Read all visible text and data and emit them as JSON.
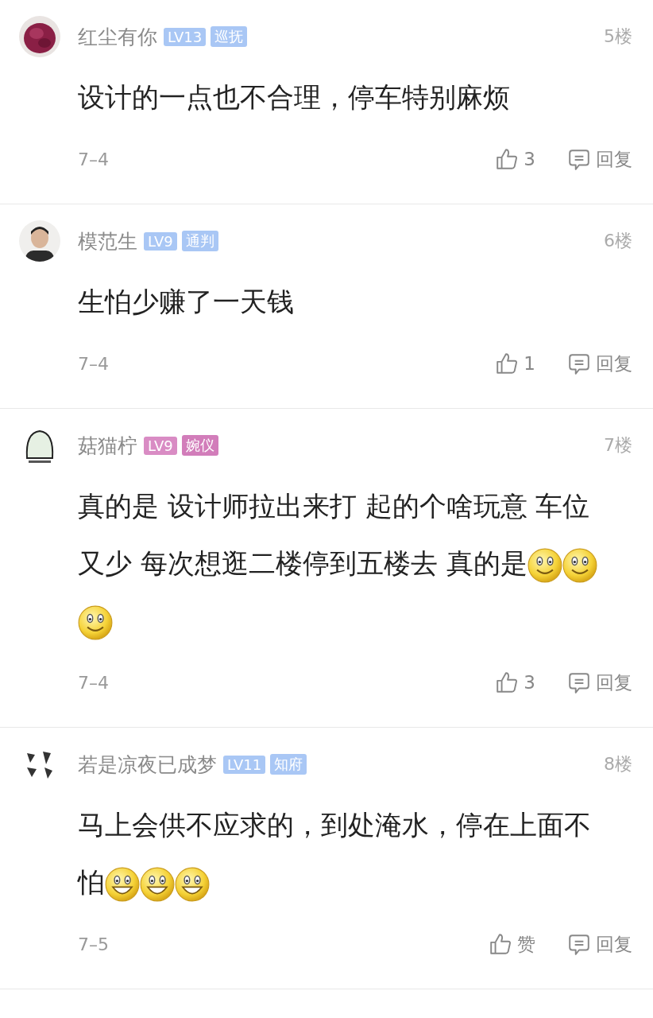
{
  "comments": [
    {
      "avatar": {
        "kind": "picture"
      },
      "name": "红尘有你",
      "badges": [
        {
          "text": "LV13",
          "color": "#a9c7f5"
        },
        {
          "text": "巡抚",
          "color": "#a9c7f5"
        }
      ],
      "floor": "5楼",
      "content": [
        {
          "kind": "text",
          "text": "设计的一点也不合理，停车特别麻烦"
        }
      ],
      "date": "7–4",
      "like": "3",
      "reply": "回复"
    },
    {
      "avatar": {
        "kind": "picture"
      },
      "name": "模范生",
      "badges": [
        {
          "text": "LV9",
          "color": "#a9c7f5"
        },
        {
          "text": "通判",
          "color": "#a9c7f5"
        }
      ],
      "floor": "6楼",
      "content": [
        {
          "kind": "text",
          "text": "生怕少赚了一天钱"
        }
      ],
      "date": "7–4",
      "like": "1",
      "reply": "回复"
    },
    {
      "avatar": {
        "kind": "picture"
      },
      "name": "菇猫柠",
      "badges": [
        {
          "text": "LV9",
          "color": "#d98cc4"
        },
        {
          "text": "婉仪",
          "color": "#d27dba"
        }
      ],
      "floor": "7楼",
      "content": [
        {
          "kind": "text",
          "text": "真的是 设计师拉出来打 起的个啥玩意 车位又少 每次想逛二楼停到五楼去 真的是"
        },
        {
          "kind": "smile"
        },
        {
          "kind": "smile"
        },
        {
          "kind": "smile"
        }
      ],
      "date": "7–4",
      "like": "3",
      "reply": "回复"
    },
    {
      "avatar": {
        "kind": "picture"
      },
      "name": "若是凉夜已成梦",
      "badges": [
        {
          "text": "LV11",
          "color": "#a9c7f5"
        },
        {
          "text": "知府",
          "color": "#a9c7f5"
        }
      ],
      "floor": "8楼",
      "content": [
        {
          "kind": "text",
          "text": "马上会供不应求的，到处淹水，停在上面不怕"
        },
        {
          "kind": "grin"
        },
        {
          "kind": "grin"
        },
        {
          "kind": "grin"
        }
      ],
      "date": "7–5",
      "like": "赞",
      "reply": "回复"
    }
  ]
}
